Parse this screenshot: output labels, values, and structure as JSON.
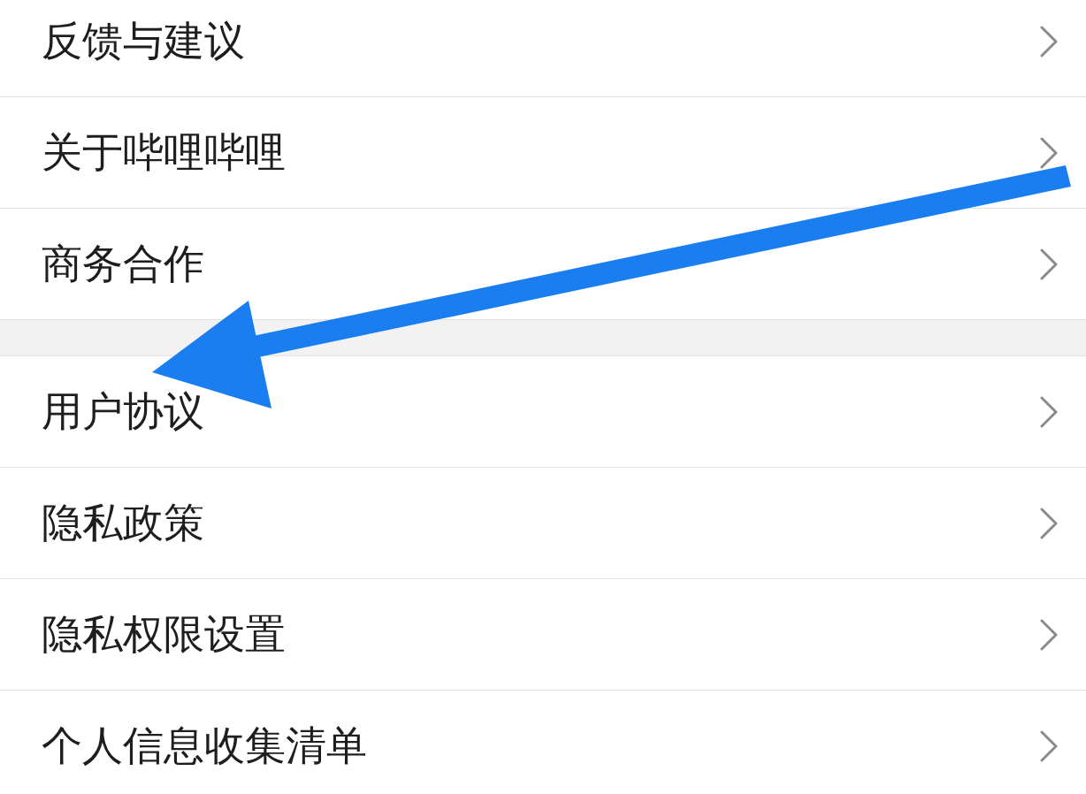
{
  "sections": [
    {
      "items": [
        {
          "label": "反馈与建议"
        },
        {
          "label": "关于哔哩哔哩"
        },
        {
          "label": "商务合作"
        }
      ]
    },
    {
      "items": [
        {
          "label": "用户协议"
        },
        {
          "label": "隐私政策"
        },
        {
          "label": "隐私权限设置"
        },
        {
          "label": "个人信息收集清单"
        }
      ]
    }
  ],
  "annotations": [
    {
      "kind": "arrow"
    }
  ]
}
